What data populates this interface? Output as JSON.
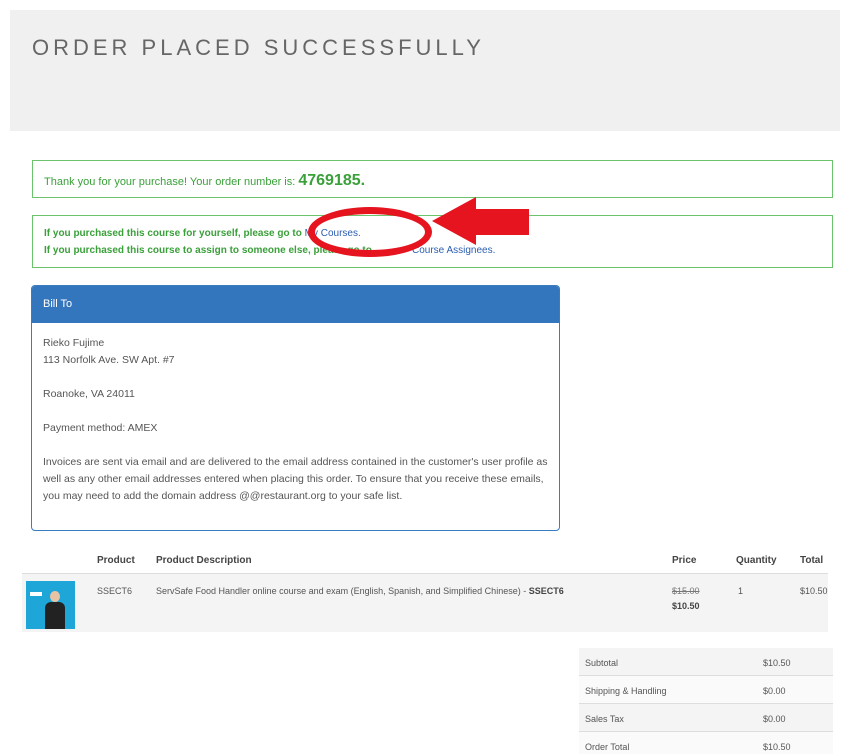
{
  "header": {
    "title": "ORDER PLACED SUCCESSFULLY"
  },
  "thanks": {
    "text": "Thank you for your purchase! Your order number is: ",
    "order_number": "4769185",
    "period": "."
  },
  "course_info": {
    "line1_prefix": "If you purchased this course for yourself, please go to ",
    "line1_link": "My Courses.",
    "line2_prefix": "If you purchased this course to assign to someone else, please go to",
    "line2_link": "Course Assignees."
  },
  "bill_to": {
    "heading": "Bill To",
    "name": "Rieko Fujime",
    "address1": "113 Norfolk Ave. SW Apt. #7",
    "city_state_zip": "Roanoke, VA 24011",
    "payment_method": "Payment method: AMEX",
    "invoice_note": "Invoices are sent via email and are delivered to the email address contained in the customer's user profile as well as any other email addresses entered when placing this order. To ensure that you receive these emails, you may need to add the domain address @@restaurant.org to your safe list."
  },
  "products": {
    "columns": {
      "product": "Product",
      "description": "Product Description",
      "price": "Price",
      "quantity": "Quantity",
      "total": "Total"
    },
    "rows": [
      {
        "code": "SSECT6",
        "description": "ServSafe Food Handler online course and exam (English, Spanish, and Simplified Chinese) - ",
        "description_code": "SSECT6",
        "original_price": "$15.00",
        "price": "$10.50",
        "quantity": "1",
        "total": "$10.50"
      }
    ]
  },
  "totals": [
    {
      "label": "Subtotal",
      "value": "$10.50"
    },
    {
      "label": "Shipping & Handling",
      "value": "$0.00"
    },
    {
      "label": "Sales Tax",
      "value": "$0.00"
    },
    {
      "label": "Order Total",
      "value": "$10.50"
    }
  ],
  "colors": {
    "success_green": "#3aa03a",
    "panel_blue": "#3476bd",
    "link_blue": "#2a5db0",
    "annotation_red": "#e5141f"
  }
}
